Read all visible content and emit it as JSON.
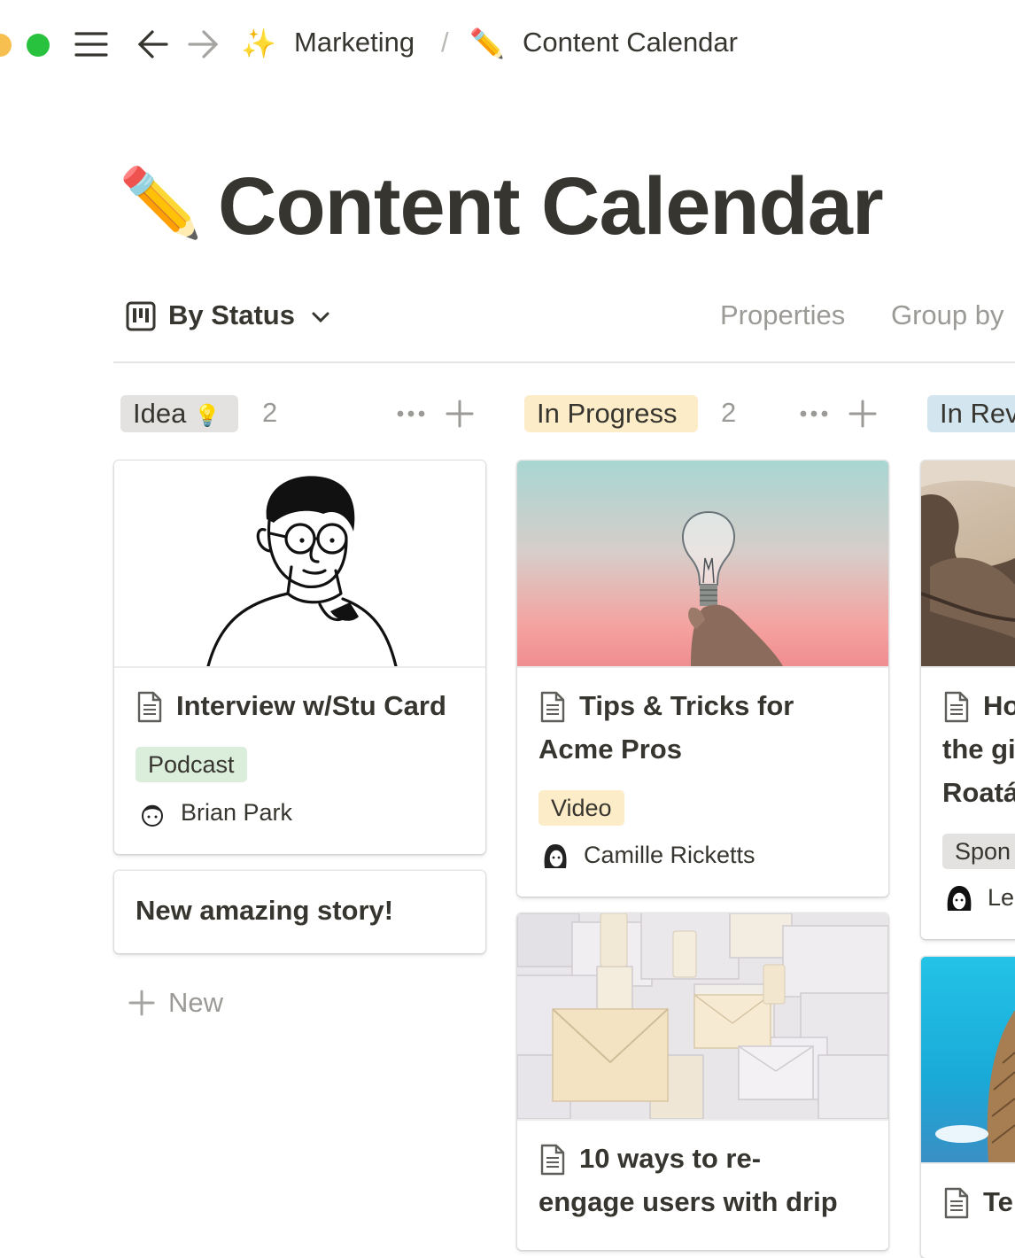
{
  "topbar": {
    "breadcrumb": [
      {
        "emoji": "✨",
        "label": "Marketing"
      },
      {
        "emoji": "✏️",
        "label": "Content Calendar"
      }
    ],
    "separator": "/"
  },
  "page": {
    "emoji": "✏️",
    "title": "Content Calendar"
  },
  "view": {
    "name": "By Status",
    "options": [
      "Properties",
      "Group by"
    ]
  },
  "columns": [
    {
      "name": "Idea",
      "emoji": "💡",
      "count": "2",
      "color": "#e3e2e0",
      "cards": [
        {
          "title": "Interview w/Stu Card",
          "tag": "Podcast",
          "tag_color": "#dbeddb",
          "person": "Brian Park",
          "cover": "illustration-portrait"
        },
        {
          "title": "New amazing story!"
        }
      ],
      "new_label": "New"
    },
    {
      "name": "In Progress",
      "count": "2",
      "color": "#fdecc8",
      "cards": [
        {
          "title_lines": [
            "Tips & Tricks for",
            "Acme Pros"
          ],
          "tag": "Video",
          "tag_color": "#fdecc8",
          "person": "Camille Ricketts",
          "cover": "lightbulb-photo"
        },
        {
          "title_lines": [
            "10 ways to re-",
            "engage users with drip"
          ],
          "cover": "envelopes-photo"
        }
      ]
    },
    {
      "name": "In Rev",
      "color": "#d3e5ef",
      "cards": [
        {
          "title_lines": [
            "Ho",
            "the gi",
            "Roatá"
          ],
          "tag": "Spon",
          "tag_color": "#e3e2e0",
          "person": "Le",
          "cover": "iguana-photo"
        },
        {
          "title": "Te",
          "cover": "pineapple-photo"
        }
      ]
    }
  ]
}
